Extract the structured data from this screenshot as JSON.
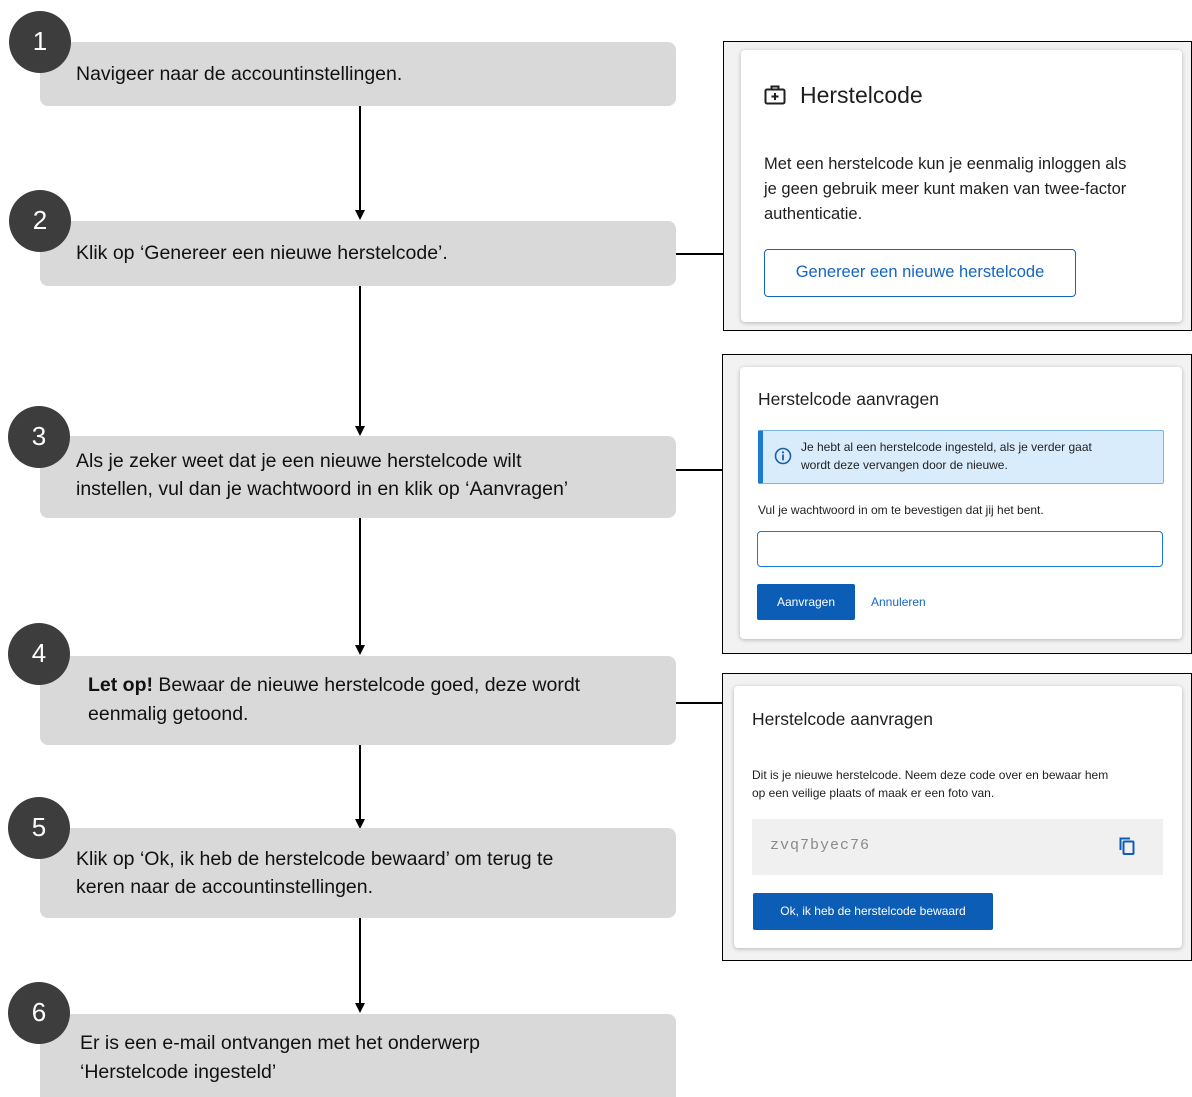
{
  "steps": [
    {
      "number": "1",
      "text": "Navigeer naar de accountinstellingen."
    },
    {
      "number": "2",
      "text": "Klik op ‘Genereer een nieuwe herstelcode’."
    },
    {
      "number": "3",
      "line1": "Als je zeker weet dat je een nieuwe herstelcode wilt",
      "line2": "instellen, vul dan je wachtwoord in en klik op ‘Aanvragen’"
    },
    {
      "number": "4",
      "bold": "Let op!",
      "line1": " Bewaar de nieuwe herstelcode goed, deze wordt",
      "line2": "eenmalig getoond."
    },
    {
      "number": "5",
      "line1": "Klik op ‘Ok, ik heb de herstelcode bewaard’ om terug te",
      "line2": "keren naar de accountinstellingen."
    },
    {
      "number": "6",
      "line1": "Er is een e-mail ontvangen met het onderwerp",
      "line2": "‘Herstelcode ingesteld’"
    }
  ],
  "screenshot1": {
    "icon": "medical-kit-icon",
    "title": "Herstelcode",
    "desc_line1": "Met een herstelcode kun je eenmalig inloggen als",
    "desc_line2": "je geen gebruik meer kunt maken van twee-factor",
    "desc_line3": "authenticatie.",
    "button": "Genereer een nieuwe herstelcode"
  },
  "screenshot2": {
    "title": "Herstelcode aanvragen",
    "info_icon": "info-icon",
    "info_line1": "Je hebt al een herstelcode ingesteld, als je verder gaat",
    "info_line2": "wordt deze vervangen door de nieuwe.",
    "prompt": "Vul je wachtwoord in om te bevestigen dat jij het bent.",
    "password_value": "",
    "submit": "Aanvragen",
    "cancel": "Annuleren"
  },
  "screenshot3": {
    "title": "Herstelcode aanvragen",
    "desc_line1": "Dit is je nieuwe herstelcode. Neem deze code over en bewaar hem",
    "desc_line2": "op een veilige plaats of maak er een foto van.",
    "code": "zvq7byec76",
    "copy_icon": "copy-icon",
    "button": "Ok, ik heb de herstelcode bewaard"
  },
  "colors": {
    "step_box": "#d9d9d9",
    "step_number": "#3d3d3d",
    "accent_blue": "#0c5db5",
    "info_bg": "#d9ecfb"
  }
}
